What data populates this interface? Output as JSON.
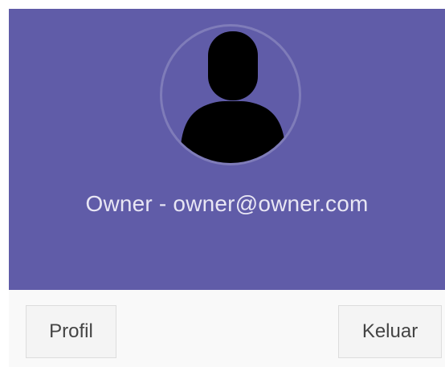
{
  "user": {
    "info": "Owner - owner@owner.com"
  },
  "footer": {
    "profile_label": "Profil",
    "logout_label": "Keluar"
  },
  "icons": {
    "avatar": "user-silhouette-icon"
  },
  "colors": {
    "header_background": "#605ca8",
    "footer_background": "#f9f9f9",
    "button_background": "#f4f4f4",
    "button_border": "#dddddd",
    "button_text": "#444444",
    "avatar_silhouette": "#000000"
  }
}
